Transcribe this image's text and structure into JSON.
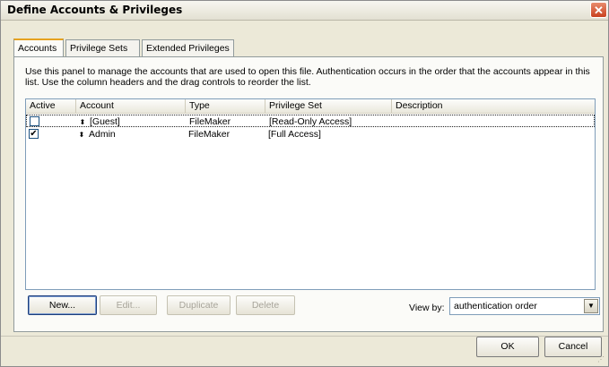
{
  "window": {
    "title": "Define Accounts & Privileges",
    "close_glyph": "✕"
  },
  "tabs": [
    {
      "label": "Accounts",
      "active": true
    },
    {
      "label": "Privilege Sets",
      "active": false
    },
    {
      "label": "Extended Privileges",
      "active": false
    }
  ],
  "panel": {
    "description": "Use this panel to manage the accounts that are used to open this file. Authentication occurs in the order that the accounts appear in this list. Use the column headers and the drag controls to reorder the list."
  },
  "table": {
    "columns": [
      "Active",
      "Account",
      "Type",
      "Privilege Set",
      "Description"
    ],
    "rows": [
      {
        "active": "",
        "account": "[Guest]",
        "type": "FileMaker",
        "privilege_set": "[Read-Only Access]",
        "description": "",
        "selected": true
      },
      {
        "active": "✔",
        "account": "Admin",
        "type": "FileMaker",
        "privilege_set": "[Full Access]",
        "description": "",
        "selected": false
      }
    ],
    "drag_glyph": "⬍"
  },
  "buttons": {
    "new": "New...",
    "edit": "Edit...",
    "duplicate": "Duplicate",
    "delete": "Delete",
    "ok": "OK",
    "cancel": "Cancel"
  },
  "view_by": {
    "label": "View by:",
    "selected": "authentication order",
    "arrow_glyph": "▼"
  }
}
